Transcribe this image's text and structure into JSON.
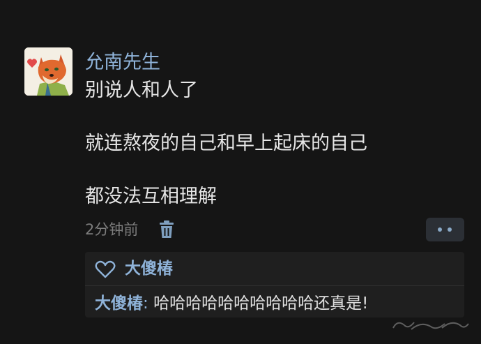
{
  "post": {
    "username": "允南先生",
    "lines": [
      "别说人和人了",
      "就连熬夜的自己和早上起床的自己",
      "都没法互相理解"
    ],
    "time": "2分钟前"
  },
  "icons": {
    "avatar": "fox-avatar",
    "delete": "trash-icon",
    "more": "more-dots-icon",
    "like": "heart-icon"
  },
  "likes": {
    "user": "大傻椿"
  },
  "reply": {
    "author": "大傻椿",
    "separator": ": ",
    "text": "哈哈哈哈哈哈哈哈哈哈还真是!"
  },
  "colors": {
    "background": "#151515",
    "username": "#8fb3d9",
    "text": "#e6e6e6",
    "muted": "#7d7d7d",
    "reply_box": "#1f1f1f"
  }
}
